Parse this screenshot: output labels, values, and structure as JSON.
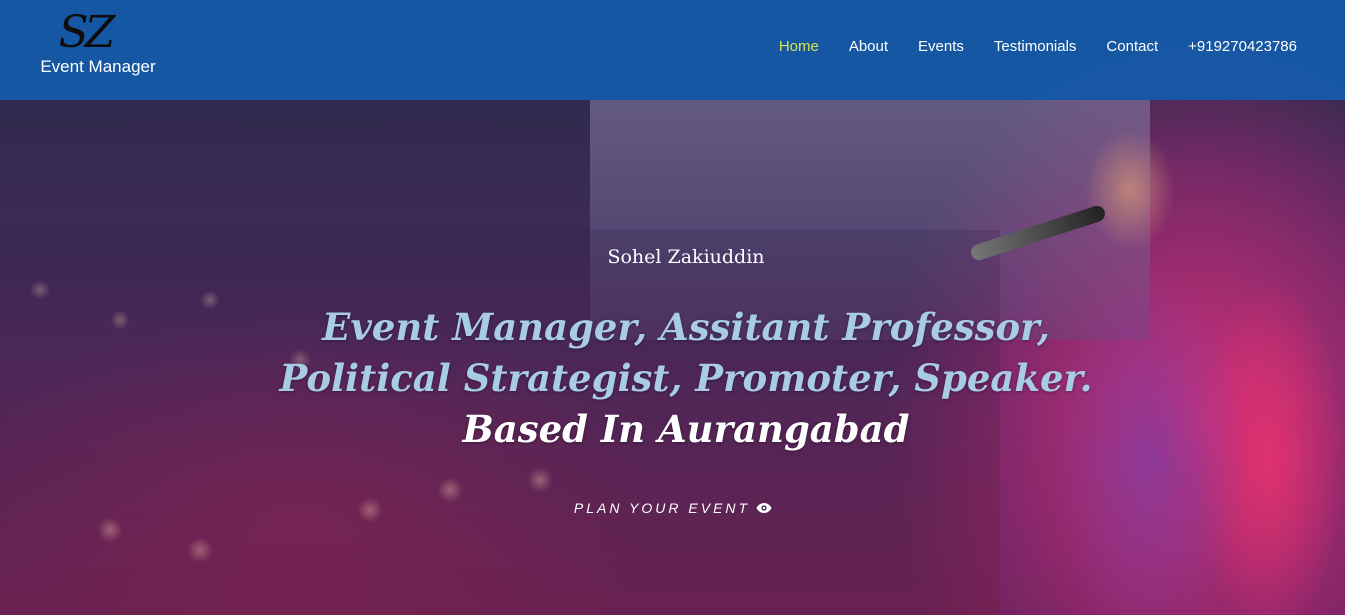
{
  "header": {
    "logo_mark": "SZ",
    "logo_text": "Event Manager",
    "nav": [
      {
        "label": "Home",
        "active": true
      },
      {
        "label": "About",
        "active": false
      },
      {
        "label": "Events",
        "active": false
      },
      {
        "label": "Testimonials",
        "active": false
      },
      {
        "label": "Contact",
        "active": false
      },
      {
        "label": "+919270423786",
        "active": false
      }
    ],
    "colors": {
      "nav_bg": "#145aaa",
      "active_link": "#d7e64a"
    }
  },
  "hero": {
    "name": "Sohel Zakiuddin",
    "title_line1": "Event Manager, Assitant Professor,",
    "title_line2": "Political Strategist, Promoter, Speaker.",
    "location": "Based In Aurangabad",
    "cta_label": "PLAN YOUR EVENT",
    "cta_icon": "eye-icon",
    "colors": {
      "title": "#a8cbe6",
      "location": "#ffffff"
    }
  }
}
